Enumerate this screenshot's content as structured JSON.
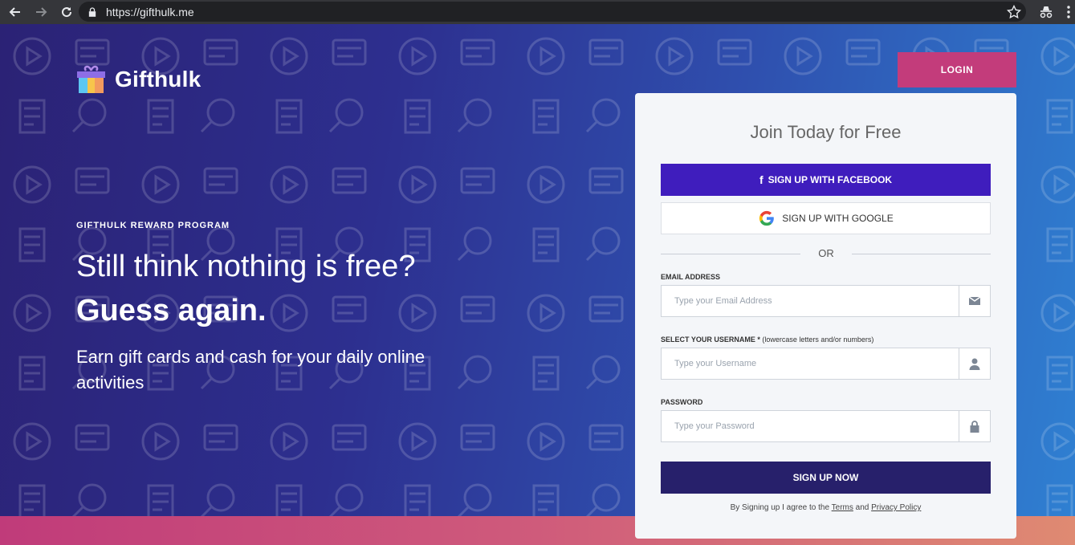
{
  "browser": {
    "url": "https://gifthulk.me",
    "back_icon": "arrow-left-icon",
    "forward_icon": "arrow-right-icon",
    "reload_icon": "reload-icon",
    "lock_icon": "lock-icon",
    "bookmark_icon": "star-icon",
    "extension_icon": "incognito-icon",
    "menu_icon": "vertical-dots-icon"
  },
  "brand": {
    "name": "Gifthulk",
    "logo_icon": "gift-box-icon"
  },
  "header": {
    "login_label": "LOGIN"
  },
  "hero": {
    "program_label": "GIFTHULK REWARD PROGRAM",
    "headline": "Still think nothing is free?",
    "headline_bold": "Guess again.",
    "subline": "Earn gift cards and cash for your daily online activities"
  },
  "signup": {
    "title": "Join Today for Free",
    "facebook_icon": "f",
    "facebook_label": "SIGN UP WITH FACEBOOK",
    "google_label": "SIGN UP WITH GOOGLE",
    "or_label": "OR",
    "email_label": "EMAIL ADDRESS",
    "email_placeholder": "Type your Email Address",
    "username_label": "SELECT YOUR USERNAME *",
    "username_hint": "(lowercase letters and/or numbers)",
    "username_placeholder": "Type your Username",
    "password_label": "PASSWORD",
    "password_placeholder": "Type your Password",
    "submit_label": "SIGN UP NOW",
    "terms_prefix": "By Signing up I agree to the",
    "terms_link": "Terms",
    "terms_and": "and",
    "privacy_link": "Privacy Policy"
  },
  "colors": {
    "login_button": "#c33c7b",
    "facebook_button": "#3f1dbd",
    "submit_button": "#27206b",
    "hero_start": "#2b2275",
    "hero_end": "#2f80d2"
  }
}
